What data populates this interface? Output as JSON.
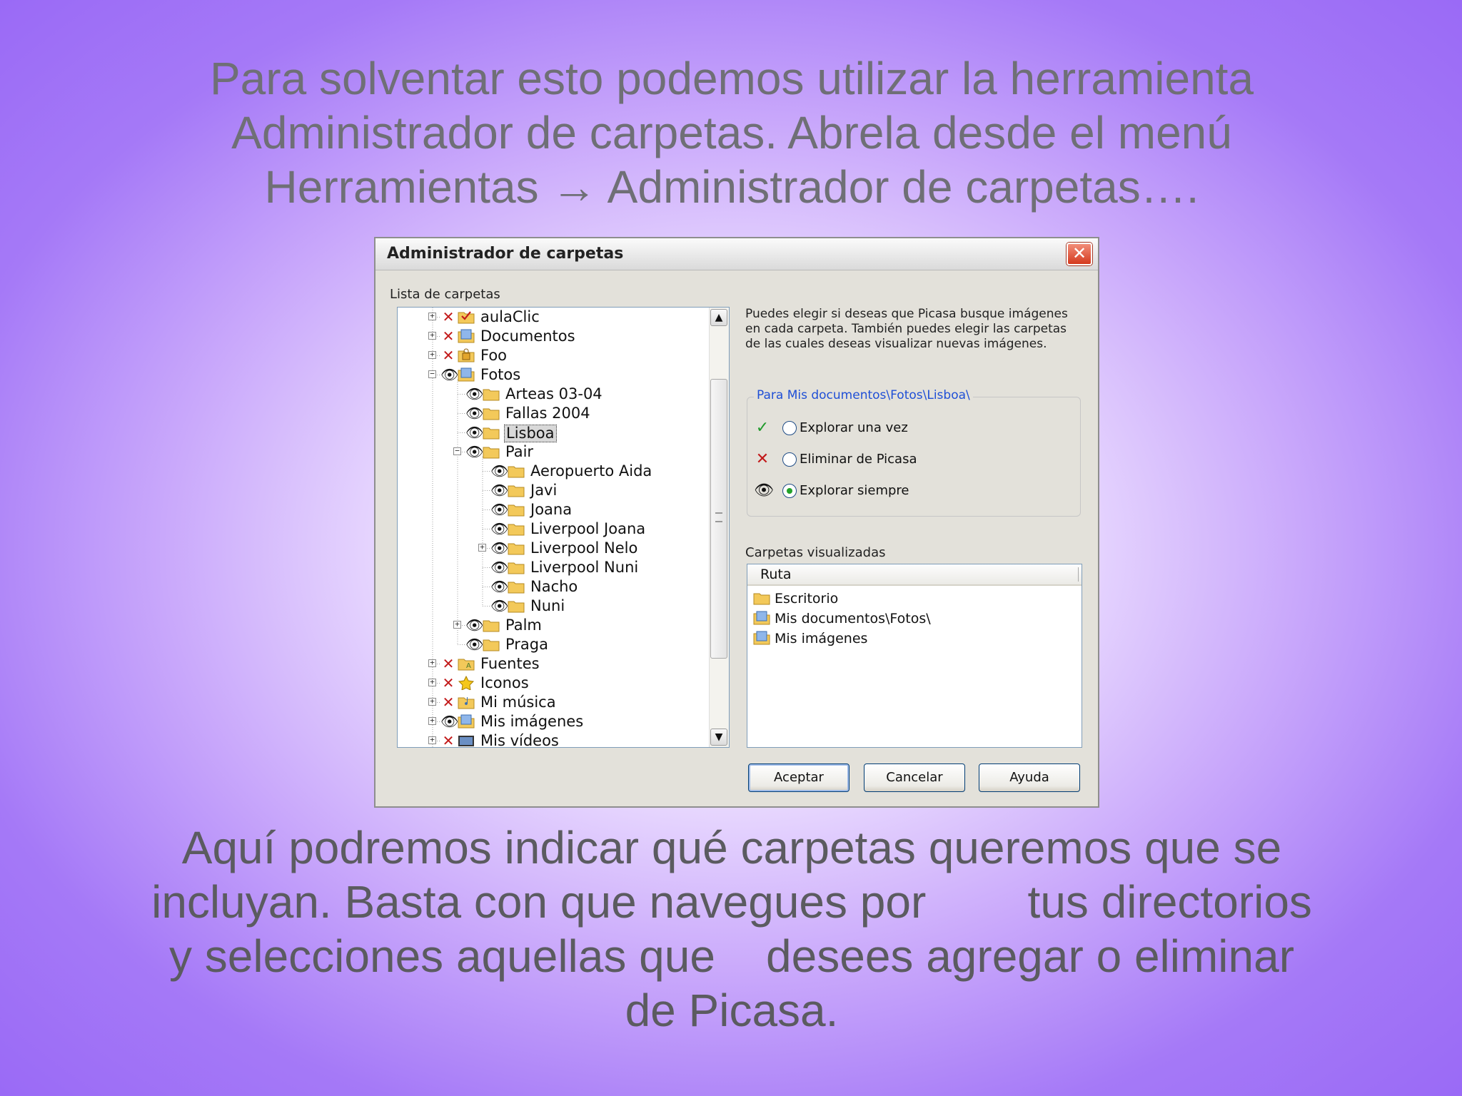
{
  "slide": {
    "heading_lines": [
      "Para solventar esto podemos utilizar la herramienta",
      "Administrador de carpetas. Abrela desde el menú",
      "Herramientas → Administrador de carpetas…."
    ],
    "caption_lines": [
      "Aquí podremos indicar qué carpetas queremos que se",
      "incluyan. Basta con que navegues por        tus directorios",
      "y selecciones aquellas que    desees agregar o eliminar",
      "de Picasa."
    ]
  },
  "dialog": {
    "title": "Administrador de carpetas",
    "close_glyph": "✕",
    "folder_list_label": "Lista de carpetas",
    "tree": [
      {
        "label": "aulaClic",
        "status": "x",
        "icon": "folder-check-icon",
        "expander": "+",
        "level": 0
      },
      {
        "label": "Documentos",
        "status": "x",
        "icon": "folder-docs-icon",
        "expander": "+",
        "level": 0
      },
      {
        "label": "Foo",
        "status": "x",
        "icon": "folder-locked-icon",
        "expander": "+",
        "level": 0
      },
      {
        "label": "Fotos",
        "status": "eye",
        "icon": "folder-pictures-icon",
        "expander": "−",
        "level": 0
      },
      {
        "label": "Arteas 03-04",
        "status": "eye",
        "icon": "folder-icon",
        "expander": "",
        "level": 1
      },
      {
        "label": "Fallas 2004",
        "status": "eye",
        "icon": "folder-icon",
        "expander": "",
        "level": 1
      },
      {
        "label": "Lisboa",
        "status": "eye",
        "icon": "folder-icon",
        "expander": "",
        "level": 1,
        "selected": true
      },
      {
        "label": "Pair",
        "status": "eye",
        "icon": "folder-icon",
        "expander": "−",
        "level": 1
      },
      {
        "label": "Aeropuerto Aida",
        "status": "eye",
        "icon": "folder-icon",
        "expander": "",
        "level": 2
      },
      {
        "label": "Javi",
        "status": "eye",
        "icon": "folder-icon",
        "expander": "",
        "level": 2
      },
      {
        "label": "Joana",
        "status": "eye",
        "icon": "folder-icon",
        "expander": "",
        "level": 2
      },
      {
        "label": "Liverpool Joana",
        "status": "eye",
        "icon": "folder-icon",
        "expander": "",
        "level": 2
      },
      {
        "label": "Liverpool Nelo",
        "status": "eye",
        "icon": "folder-icon",
        "expander": "+",
        "level": 2
      },
      {
        "label": "Liverpool Nuni",
        "status": "eye",
        "icon": "folder-icon",
        "expander": "",
        "level": 2
      },
      {
        "label": "Nacho",
        "status": "eye",
        "icon": "folder-icon",
        "expander": "",
        "level": 2
      },
      {
        "label": "Nuni",
        "status": "eye",
        "icon": "folder-icon",
        "expander": "",
        "level": 2
      },
      {
        "label": "Palm",
        "status": "eye",
        "icon": "folder-icon",
        "expander": "+",
        "level": 1
      },
      {
        "label": "Praga",
        "status": "eye",
        "icon": "folder-icon",
        "expander": "",
        "level": 1
      },
      {
        "label": "Fuentes",
        "status": "x",
        "icon": "folder-fonts-icon",
        "expander": "+",
        "level": 0
      },
      {
        "label": "Iconos",
        "status": "x",
        "icon": "star-folder-icon",
        "expander": "+",
        "level": 0
      },
      {
        "label": "Mi música",
        "status": "x",
        "icon": "folder-music-icon",
        "expander": "+",
        "level": 0
      },
      {
        "label": "Mis imágenes",
        "status": "eye",
        "icon": "folder-pictures-icon",
        "expander": "+",
        "level": 0
      },
      {
        "label": "Mis vídeos",
        "status": "x",
        "icon": "folder-video-icon",
        "expander": "+",
        "level": 0
      }
    ],
    "description": "Puedes elegir si deseas que Picasa busque imágenes en cada carpeta. También puedes elegir las carpetas de las cuales deseas visualizar nuevas imágenes.",
    "group_title": "Para Mis documentos\\Fotos\\Lisboa\\",
    "options": [
      {
        "label": "Explorar una vez",
        "icon": "check",
        "checked": false
      },
      {
        "label": "Eliminar de Picasa",
        "icon": "x",
        "checked": false
      },
      {
        "label": "Explorar siempre",
        "icon": "eye",
        "checked": true
      }
    ],
    "watched_label": "Carpetas visualizadas",
    "watched_header": "Ruta",
    "watched": [
      {
        "path": "Escritorio",
        "icon": "folder-icon"
      },
      {
        "path": "Mis documentos\\Fotos\\",
        "icon": "folder-pictures-icon"
      },
      {
        "path": "Mis imágenes",
        "icon": "folder-pictures-icon"
      }
    ],
    "buttons": {
      "accept": "Aceptar",
      "cancel": "Cancelar",
      "help": "Ayuda"
    },
    "colors": {
      "x": "#c21a1a",
      "check": "#1f9a2a",
      "group_title": "#1f4fd6",
      "folder": "#f3c95a"
    }
  }
}
